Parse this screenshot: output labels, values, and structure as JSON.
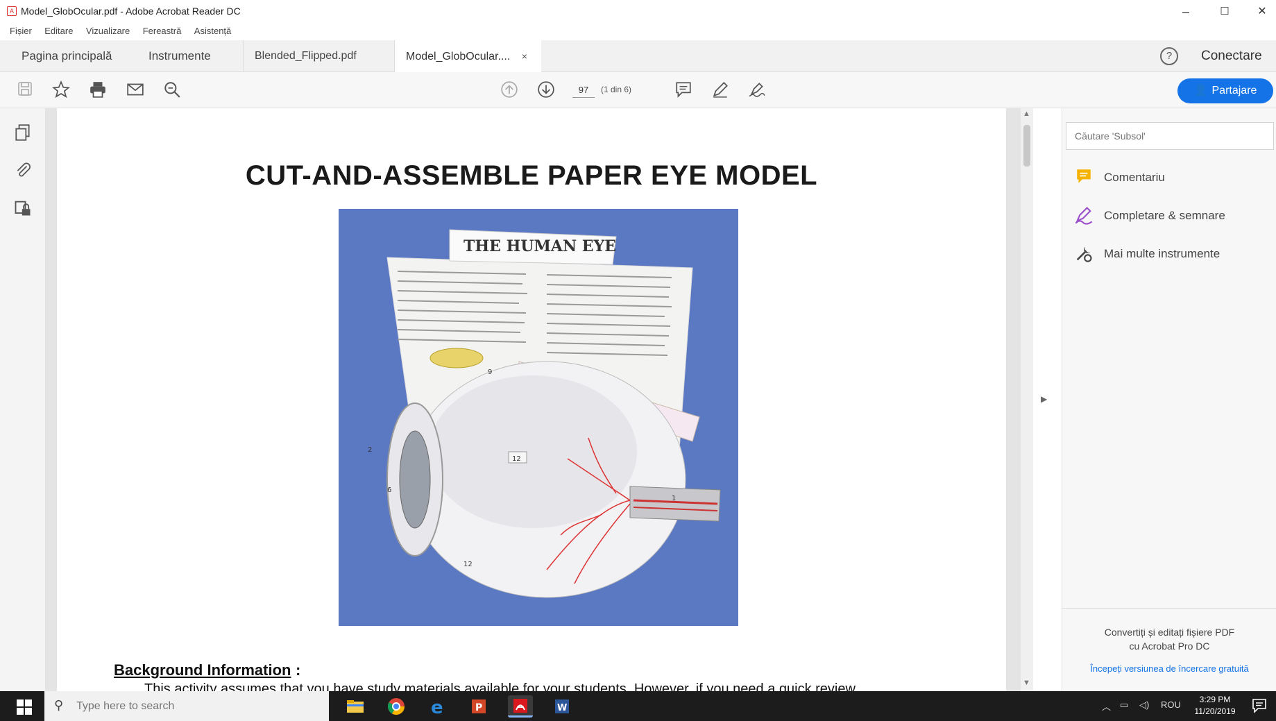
{
  "window": {
    "title": "Model_GlobOcular.pdf - Adobe Acrobat Reader DC",
    "controls": {
      "minimize": "–",
      "maximize": "☐",
      "close": "✕"
    }
  },
  "menu": [
    "Fișier",
    "Editare",
    "Vizualizare",
    "Fereastră",
    "Asistență"
  ],
  "tabs": {
    "home": "Pagina principală",
    "tools": "Instrumente",
    "files": [
      {
        "label": "Blended_Flipped.pdf",
        "active": false
      },
      {
        "label": "Model_GlobOcular....",
        "active": true
      }
    ],
    "close": "×",
    "help_icon": "?",
    "signin": "Conectare"
  },
  "toolbar": {
    "page_value": "97",
    "page_count": "(1 din 6)",
    "share_label": "Partajare",
    "icons": [
      "save-icon",
      "bookmark-star-icon",
      "print-icon",
      "email-icon",
      "zoom-search-icon",
      "page-up-icon",
      "page-down-icon",
      "comment-icon",
      "pen-icon",
      "sign-icon"
    ]
  },
  "document": {
    "title": "CUT-AND-ASSEMBLE PAPER EYE MODEL",
    "image": {
      "heading": "THE HUMAN EYE",
      "number_labels": [
        "12",
        "12",
        "9",
        "2",
        "6",
        "1"
      ]
    },
    "section_heading": "Background Information",
    "section_colon": ":",
    "body_line": "This activity assumes that you have study materials available for your students.  However, if you need a quick review"
  },
  "right_panel": {
    "search_placeholder": "Căutare 'Subsol'",
    "tools": [
      {
        "label": "Comentariu",
        "icon": "comment-tool-icon",
        "color": "#f6b200"
      },
      {
        "label": "Completare & semnare",
        "icon": "fill-sign-icon",
        "color": "#9b4fc9"
      },
      {
        "label": "Mai multe instrumente",
        "icon": "more-tools-icon",
        "color": "#444444"
      }
    ],
    "promo_line1": "Convertiți și editați fișiere PDF",
    "promo_line2": "cu Acrobat Pro DC",
    "trial_link": "Începeți versiunea de încercare gratuită"
  },
  "taskbar": {
    "search_placeholder": "Type here to search",
    "language": "ROU",
    "time": "3:29 PM",
    "date": "11/20/2019"
  },
  "colors": {
    "accent": "#1473e6",
    "eye_bg": "#5b78c3"
  }
}
